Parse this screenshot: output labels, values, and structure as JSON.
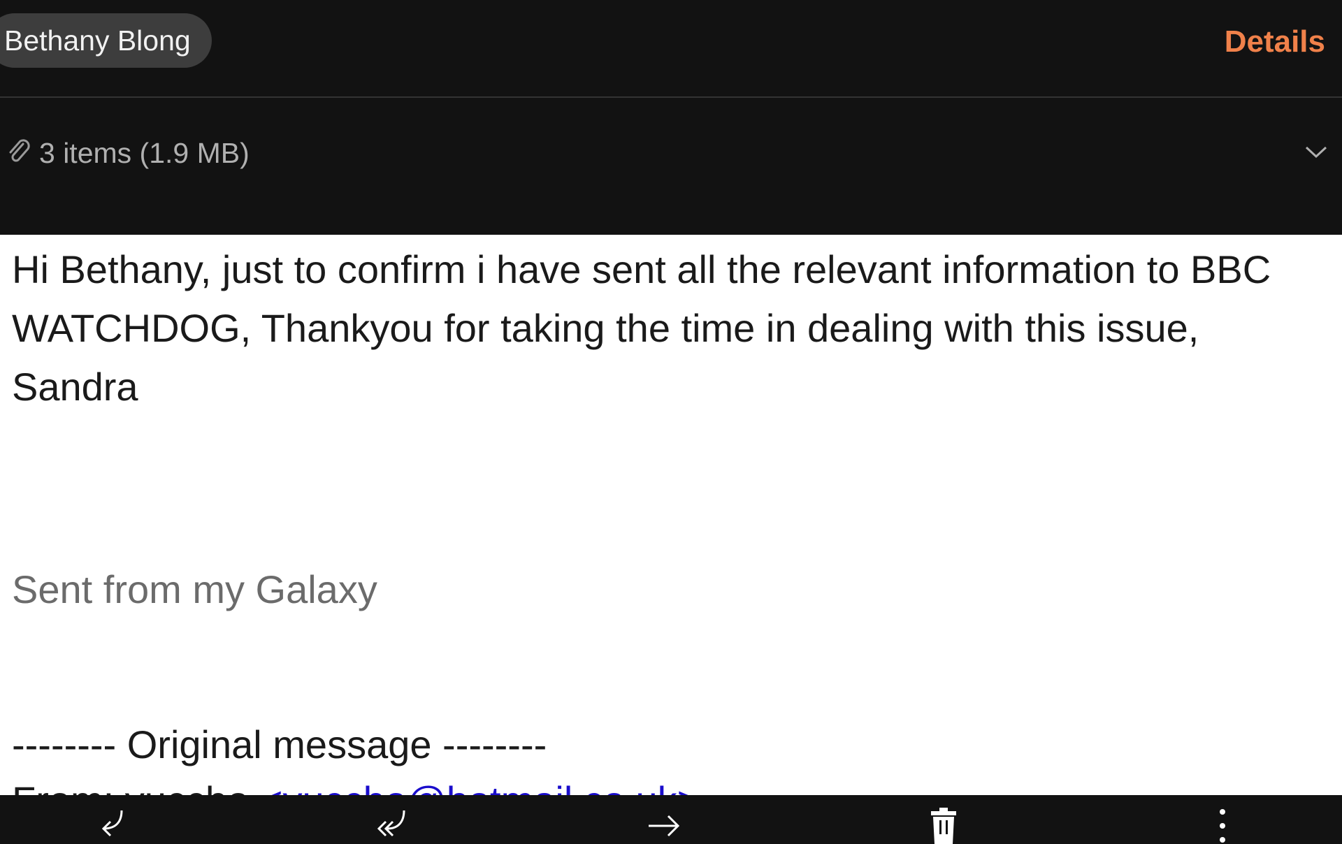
{
  "header": {
    "recipient": "Bethany Blong",
    "details_label": "Details"
  },
  "attachments": {
    "summary": "3 items (1.9 MB)",
    "icon": "paperclip-icon",
    "expand_icon": "chevron-down-icon"
  },
  "email": {
    "body_text": "Hi Bethany, just to confirm i have sent all the relevant information to BBC WATCHDOG, Thankyou for taking the time in dealing with this issue, Sandra",
    "signature": "Sent from my Galaxy",
    "original_header": "-------- Original message --------",
    "from_label": "From: yuccho ",
    "from_email": "<yuccho@hotmail.co.uk>"
  },
  "toolbar": {
    "reply_icon": "reply-icon",
    "reply_all_icon": "reply-all-icon",
    "forward_icon": "forward-icon",
    "delete_icon": "trash-icon",
    "more_icon": "more-vertical-icon"
  },
  "colors": {
    "accent": "#f0814a",
    "dark_background": "#121212",
    "chip_background": "#3d3d3d",
    "link": "#1a0dcc"
  }
}
